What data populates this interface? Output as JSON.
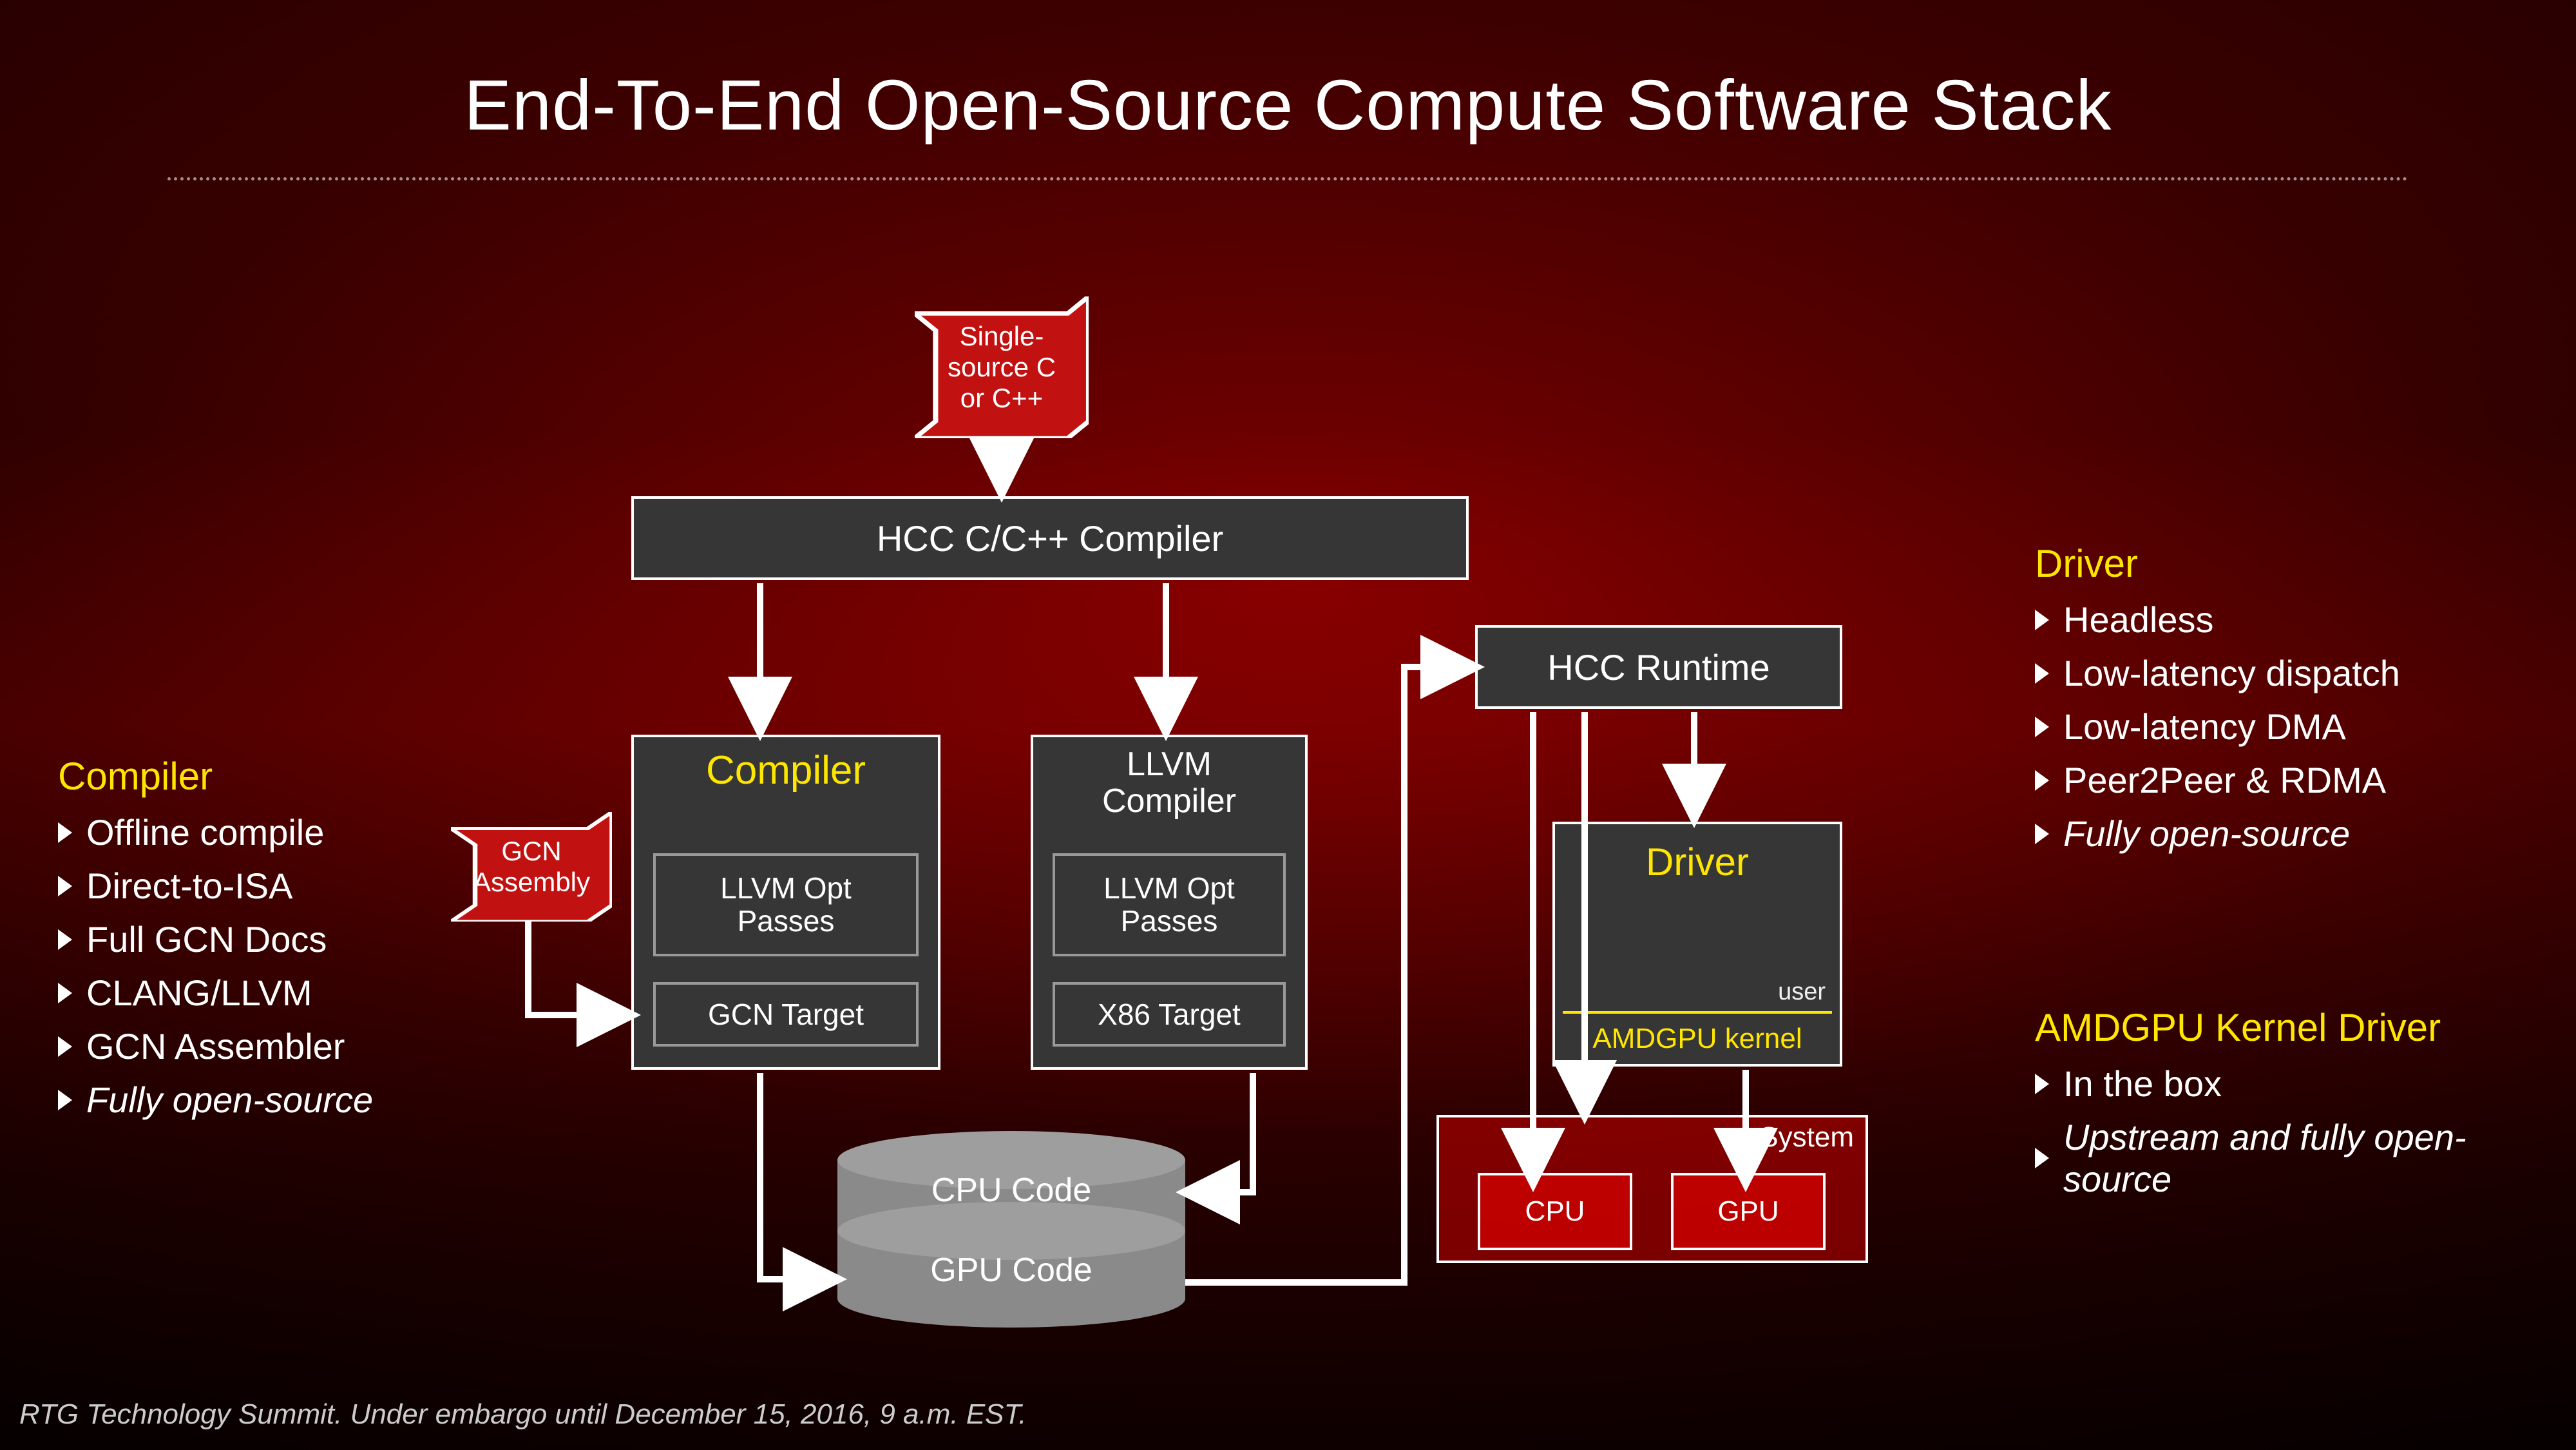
{
  "title": "End-To-End Open-Source Compute Software Stack",
  "footer": "RTG Technology Summit. Under embargo until December 15, 2016, 9 a.m. EST.",
  "ribbons": {
    "source": "Single-\nsource C\nor C++",
    "gcn_asm": "GCN\nAssembly"
  },
  "boxes": {
    "hcc_compiler": "HCC C/C++ Compiler",
    "compiler": {
      "heading": "Compiler",
      "pass1": "LLVM Opt\nPasses",
      "pass2": "GCN Target"
    },
    "llvm": {
      "heading": "LLVM\nCompiler",
      "pass1": "LLVM Opt\nPasses",
      "pass2": "X86 Target"
    },
    "hcc_runtime": "HCC Runtime",
    "driver": {
      "heading": "Driver",
      "user": "user",
      "kernel": "AMDGPU kernel"
    }
  },
  "cylinder": {
    "cpu": "CPU Code",
    "gpu": "GPU Code"
  },
  "system": {
    "label": "System",
    "cpu": "CPU",
    "gpu": "GPU"
  },
  "left_panel": {
    "heading": "Compiler",
    "items": [
      {
        "text": "Offline compile"
      },
      {
        "text": "Direct-to-ISA"
      },
      {
        "text": "Full GCN Docs"
      },
      {
        "text": "CLANG/LLVM"
      },
      {
        "text": "GCN Assembler"
      },
      {
        "text": "Fully open-source",
        "italic": true
      }
    ]
  },
  "right_driver": {
    "heading": "Driver",
    "items": [
      {
        "text": "Headless"
      },
      {
        "text": "Low-latency dispatch"
      },
      {
        "text": "Low-latency DMA"
      },
      {
        "text": "Peer2Peer & RDMA"
      },
      {
        "text": "Fully open-source",
        "italic": true
      }
    ]
  },
  "right_kernel": {
    "heading": "AMDGPU Kernel Driver",
    "items": [
      {
        "text": "In the box"
      },
      {
        "text": "Upstream and fully open-source",
        "italic": true
      }
    ]
  }
}
